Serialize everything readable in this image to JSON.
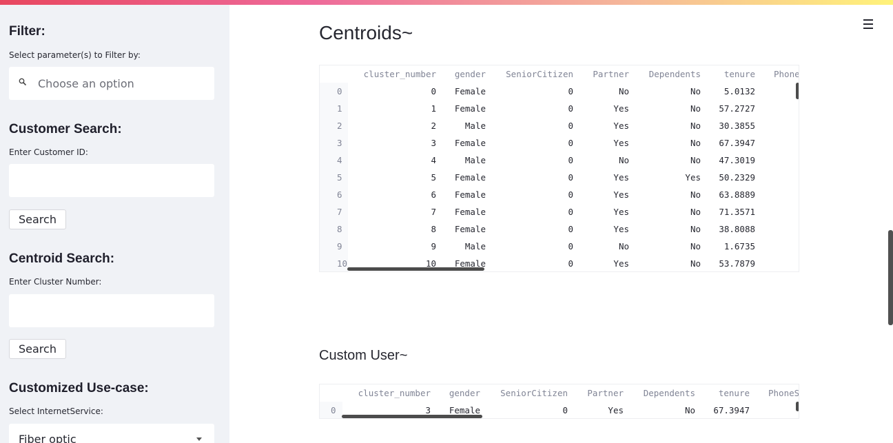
{
  "sidebar": {
    "filter_heading": "Filter:",
    "filter_label": "Select parameter(s) to Filter by:",
    "filter_placeholder": "Choose an option",
    "customer_heading": "Customer Search:",
    "customer_label": "Enter Customer ID:",
    "customer_value": "",
    "customer_button": "Search",
    "centroid_heading": "Centroid Search:",
    "centroid_label": "Enter Cluster Number:",
    "centroid_value": "",
    "centroid_button": "Search",
    "usecase_heading": "Customized Use-case:",
    "usecase_label": "Select InternetService:",
    "usecase_value": "Fiber optic"
  },
  "main": {
    "centroids_title": "Centroids~",
    "custom_title": "Custom User~"
  },
  "centroids_table": {
    "columns": [
      "cluster_number",
      "gender",
      "SeniorCitizen",
      "Partner",
      "Dependents",
      "tenure",
      "PhoneS"
    ],
    "rows": [
      {
        "index": "0",
        "cells": [
          "0",
          "Female",
          "0",
          "No",
          "No",
          "5.0132"
        ]
      },
      {
        "index": "1",
        "cells": [
          "1",
          "Female",
          "0",
          "Yes",
          "No",
          "57.2727"
        ]
      },
      {
        "index": "2",
        "cells": [
          "2",
          "Male",
          "0",
          "Yes",
          "No",
          "30.3855"
        ]
      },
      {
        "index": "3",
        "cells": [
          "3",
          "Female",
          "0",
          "Yes",
          "No",
          "67.3947"
        ]
      },
      {
        "index": "4",
        "cells": [
          "4",
          "Male",
          "0",
          "No",
          "No",
          "47.3019"
        ]
      },
      {
        "index": "5",
        "cells": [
          "5",
          "Female",
          "0",
          "Yes",
          "Yes",
          "50.2329"
        ]
      },
      {
        "index": "6",
        "cells": [
          "6",
          "Female",
          "0",
          "Yes",
          "No",
          "63.8889"
        ]
      },
      {
        "index": "7",
        "cells": [
          "7",
          "Female",
          "0",
          "Yes",
          "No",
          "71.3571"
        ]
      },
      {
        "index": "8",
        "cells": [
          "8",
          "Female",
          "0",
          "Yes",
          "No",
          "38.8088"
        ]
      },
      {
        "index": "9",
        "cells": [
          "9",
          "Male",
          "0",
          "No",
          "No",
          "1.6735"
        ]
      },
      {
        "index": "10",
        "cells": [
          "10",
          "Female",
          "0",
          "Yes",
          "No",
          "53.7879"
        ]
      }
    ]
  },
  "custom_table": {
    "columns": [
      "cluster_number",
      "gender",
      "SeniorCitizen",
      "Partner",
      "Dependents",
      "tenure",
      "PhoneS"
    ],
    "rows": [
      {
        "index": "0",
        "cells": [
          "3",
          "Female",
          "0",
          "Yes",
          "No",
          "67.3947"
        ]
      }
    ]
  },
  "icons": {
    "search": "magnifier-icon",
    "menu": "hamburger-icon",
    "dropdown": "chevron-down-icon"
  },
  "colors": {
    "accent_gradient_start": "#e8475f",
    "accent_gradient_end": "#fff27a",
    "sidebar_bg": "#f0f2f6"
  }
}
